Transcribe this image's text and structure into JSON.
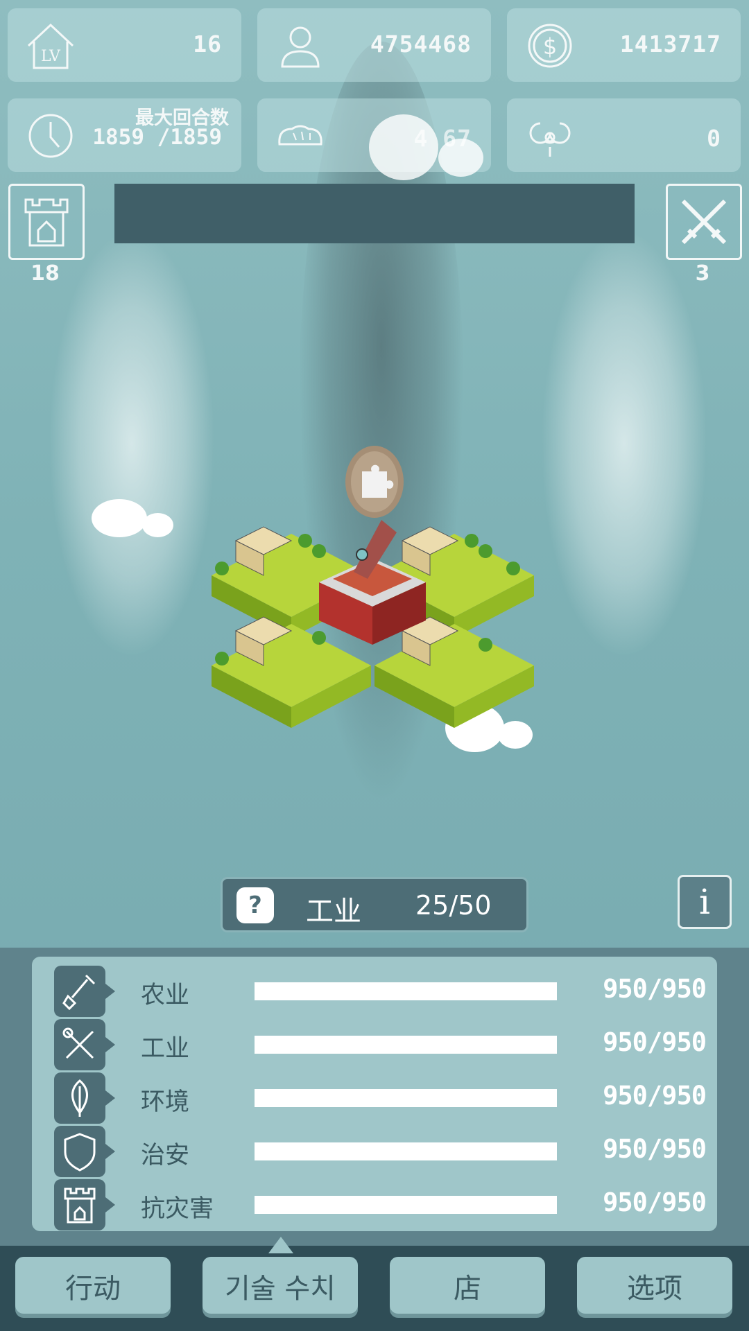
{
  "stats": {
    "level": "16",
    "population": "4754468",
    "money": "1413717",
    "max_turns_label": "最大回合数",
    "turns": "1859  /1859",
    "food": "4 67",
    "hazard": "0"
  },
  "corners": {
    "castle_count": "18",
    "battle_count": "3"
  },
  "sector": {
    "help": "?",
    "name": "工业",
    "value": "25/50"
  },
  "info_label": "i",
  "tech_rows": [
    {
      "label": "农业",
      "value": "950/950",
      "progress": 1.0,
      "icon": "shovel-icon"
    },
    {
      "label": "工业",
      "value": "950/950",
      "progress": 1.0,
      "icon": "tools-icon"
    },
    {
      "label": "环境",
      "value": "950/950",
      "progress": 1.0,
      "icon": "leaf-icon"
    },
    {
      "label": "治安",
      "value": "950/950",
      "progress": 1.0,
      "icon": "shield-icon"
    },
    {
      "label": "抗灾害",
      "value": "950/950",
      "progress": 1.0,
      "icon": "castle-icon"
    }
  ],
  "tabs": [
    {
      "label": "行动"
    },
    {
      "label": "기술 수치"
    },
    {
      "label": "店"
    },
    {
      "label": "选项"
    }
  ],
  "colors": {
    "panel_dark": "#4d6d76",
    "panel_light": "#9fc6c9",
    "tab_bar": "#2f4d56"
  }
}
